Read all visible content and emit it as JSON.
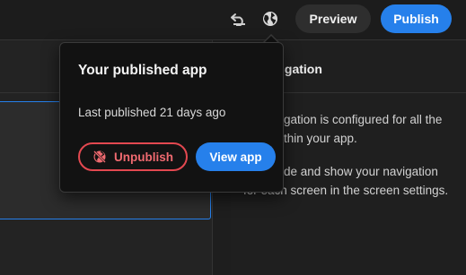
{
  "toolbar": {
    "undo_icon": "undo-icon",
    "globe_icon": "globe-icon",
    "preview_label": "Preview",
    "publish_label": "Publish"
  },
  "right_panel": {
    "title_visible": "igation",
    "line1": "igation is configured for all the",
    "line2": "ithin your app.",
    "line3": "ide and show your navigation",
    "line4": "for each screen in the screen settings."
  },
  "popover": {
    "title": "Your published app",
    "subtitle": "Last published 21 days ago",
    "unpublish_label": "Unpublish",
    "unpublish_icon": "globe-slash-icon",
    "view_app_label": "View app"
  },
  "colors": {
    "accent": "#2680eb",
    "danger": "#e34850"
  }
}
